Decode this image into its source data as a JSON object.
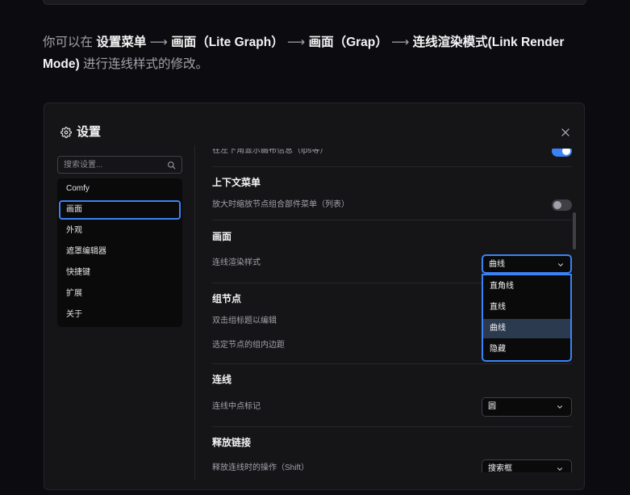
{
  "doc": {
    "intro": "你可以在",
    "arrow": "⟶",
    "step_1": "设置菜单",
    "step_2": "画面（Lite Graph）",
    "step_3": "画面（Grap）",
    "step_4": "连线渲染模式(Link Render Mode)",
    "outro": "进行连线样式的修改。"
  },
  "dialog": {
    "title": "设置",
    "icons": {
      "title": "gear-icon",
      "close": "close-icon",
      "search": "search-icon",
      "select": "chevron-down-icon"
    },
    "search": {
      "placeholder": "搜索设置..."
    },
    "categories": [
      {
        "label": "Comfy",
        "selected": false
      },
      {
        "label": "画面",
        "selected": true
      },
      {
        "label": "外观",
        "selected": false
      },
      {
        "label": "遮罩编辑器",
        "selected": false
      },
      {
        "label": "快捷键",
        "selected": false
      },
      {
        "label": "扩展",
        "selected": false
      },
      {
        "label": "关于",
        "selected": false
      }
    ],
    "settings": {
      "partial_row": {
        "label": "在左下角显示画布信息（fps等）",
        "enabled": true
      },
      "sections": [
        {
          "heading": "上下文菜单",
          "rows": [
            {
              "label": "放大时缩放节点组合部件菜单（列表）",
              "enabled": false
            }
          ]
        },
        {
          "heading": "画面",
          "rows": [
            {
              "label": "连线渲染样式",
              "value": "曲线",
              "open": true,
              "options": [
                {
                  "label": "直角线",
                  "highlighted": false
                },
                {
                  "label": "直线",
                  "highlighted": false
                },
                {
                  "label": "曲线",
                  "highlighted": true
                },
                {
                  "label": "隐藏",
                  "highlighted": false
                }
              ]
            }
          ]
        },
        {
          "heading": "组节点",
          "rows": [
            {
              "label": "双击组标题以编辑"
            },
            {
              "label": "选定节点的组内边距"
            }
          ]
        },
        {
          "heading": "连线",
          "rows": [
            {
              "label": "连线中点标记",
              "value": "圆"
            }
          ]
        },
        {
          "heading": "释放链接",
          "rows": [
            {
              "label": "释放连线时的操作（Shift）",
              "value": "搜索框"
            }
          ]
        }
      ]
    }
  },
  "colors": {
    "accent": "#3b82f6",
    "option_highlight": "#2c3a4f",
    "page_bg": "#0c0c10"
  }
}
